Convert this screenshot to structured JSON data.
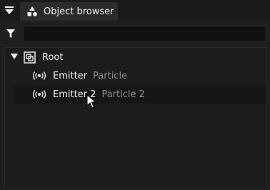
{
  "panel": {
    "tab_title": "Object browser",
    "tab_icon": "shapes-icon",
    "collapse_icon": "collapse-arrow-icon"
  },
  "filter": {
    "icon": "filter-icon",
    "value": "",
    "placeholder": ""
  },
  "tree": {
    "root": {
      "name": "Root",
      "icon": "group-icon",
      "expanded": true
    },
    "children": [
      {
        "name": "Emitter",
        "type": "Particle",
        "icon": "emitter-icon"
      },
      {
        "name": "Emitter 2",
        "type": "Particle 2",
        "icon": "emitter-icon",
        "hovered": true
      }
    ]
  },
  "colors": {
    "background": "#1f1f1f",
    "tab": "#2b2b2b",
    "input": "#111111",
    "text": "#f0f0f0",
    "muted_text": "#8c8c8c"
  }
}
